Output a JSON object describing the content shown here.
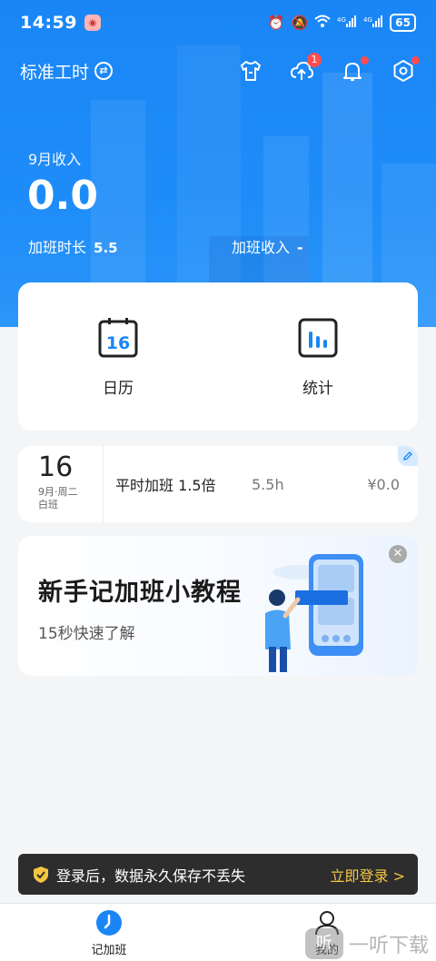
{
  "status_bar": {
    "time": "14:59",
    "battery": "65",
    "network": "4G"
  },
  "header": {
    "mode_label": "标准工时",
    "upload_badge": "1"
  },
  "summary": {
    "income_label": "9月收入",
    "income_value": "0.0",
    "ot_hours_label": "加班时长",
    "ot_hours_value": "5.5",
    "ot_income_label": "加班收入",
    "ot_income_value": "-"
  },
  "nav": {
    "calendar_day": "16",
    "calendar_label": "日历",
    "stats_label": "统计"
  },
  "record": {
    "day": "16",
    "week": "9月·周二",
    "shift": "白班",
    "type": "平时加班 1.5倍",
    "hours": "5.5h",
    "amount": "¥0.0"
  },
  "tutorial": {
    "title": "新手记加班小教程",
    "subtitle": "15秒快速了解"
  },
  "login_banner": {
    "message": "登录后，数据永久保存不丢失",
    "action": "立即登录 >"
  },
  "tabs": [
    {
      "label": "记加班",
      "active": true
    },
    {
      "label": "我的",
      "active": false
    }
  ],
  "colors": {
    "brand_blue": "#1a86f6",
    "badge_red": "#ff4d4f",
    "login_accent": "#f5c542"
  }
}
